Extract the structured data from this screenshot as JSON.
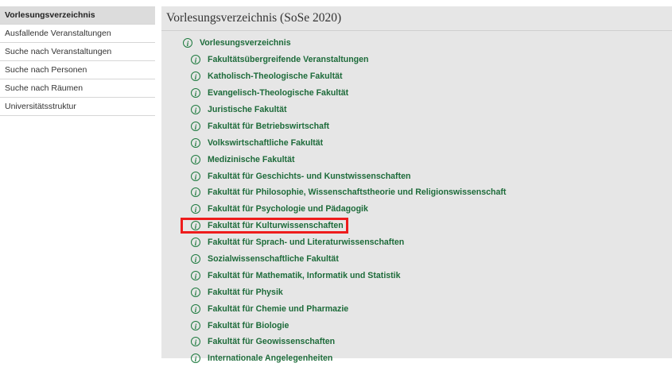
{
  "sidebar": {
    "items": [
      {
        "label": "Vorlesungsverzeichnis",
        "active": true
      },
      {
        "label": "Ausfallende Veranstaltungen",
        "active": false
      },
      {
        "label": "Suche nach Veranstaltungen",
        "active": false
      },
      {
        "label": "Suche nach Personen",
        "active": false
      },
      {
        "label": "Suche nach Räumen",
        "active": false
      },
      {
        "label": "Universitätsstruktur",
        "active": false
      }
    ]
  },
  "main": {
    "title": "Vorlesungsverzeichnis (SoSe 2020)",
    "root": {
      "label": "Vorlesungsverzeichnis",
      "icon": "info-icon"
    },
    "children": [
      {
        "label": "Fakultätsübergreifende Veranstaltungen",
        "icon": "info-icon"
      },
      {
        "label": "Katholisch-Theologische Fakultät",
        "icon": "info-icon"
      },
      {
        "label": "Evangelisch-Theologische Fakultät",
        "icon": "info-icon"
      },
      {
        "label": "Juristische Fakultät",
        "icon": "info-icon"
      },
      {
        "label": "Fakultät für Betriebswirtschaft",
        "icon": "info-icon"
      },
      {
        "label": "Volkswirtschaftliche Fakultät",
        "icon": "info-icon"
      },
      {
        "label": "Medizinische Fakultät",
        "icon": "info-icon"
      },
      {
        "label": "Fakultät für Geschichts- und Kunstwissenschaften",
        "icon": "info-icon"
      },
      {
        "label": "Fakultät für Philosophie, Wissenschaftstheorie und Religionswissenschaft",
        "icon": "info-icon"
      },
      {
        "label": "Fakultät für Psychologie und Pädagogik",
        "icon": "info-icon"
      },
      {
        "label": "Fakultät für Kulturwissenschaften",
        "icon": "info-icon",
        "highlighted": true
      },
      {
        "label": "Fakultät für Sprach- und Literaturwissenschaften",
        "icon": "info-icon"
      },
      {
        "label": "Sozialwissenschaftliche Fakultät",
        "icon": "info-icon"
      },
      {
        "label": "Fakultät für Mathematik, Informatik und Statistik",
        "icon": "info-icon"
      },
      {
        "label": "Fakultät für Physik",
        "icon": "info-icon"
      },
      {
        "label": "Fakultät für Chemie und Pharmazie",
        "icon": "info-icon"
      },
      {
        "label": "Fakultät für Biologie",
        "icon": "info-icon"
      },
      {
        "label": "Fakultät für Geowissenschaften",
        "icon": "info-icon"
      },
      {
        "label": "Internationale Angelegenheiten",
        "icon": "info-icon"
      }
    ]
  },
  "colors": {
    "link": "#1d6b3a",
    "highlight": "#ee1c1c",
    "panel": "#e6e6e6",
    "sidebar_active": "#dcdcdc"
  }
}
